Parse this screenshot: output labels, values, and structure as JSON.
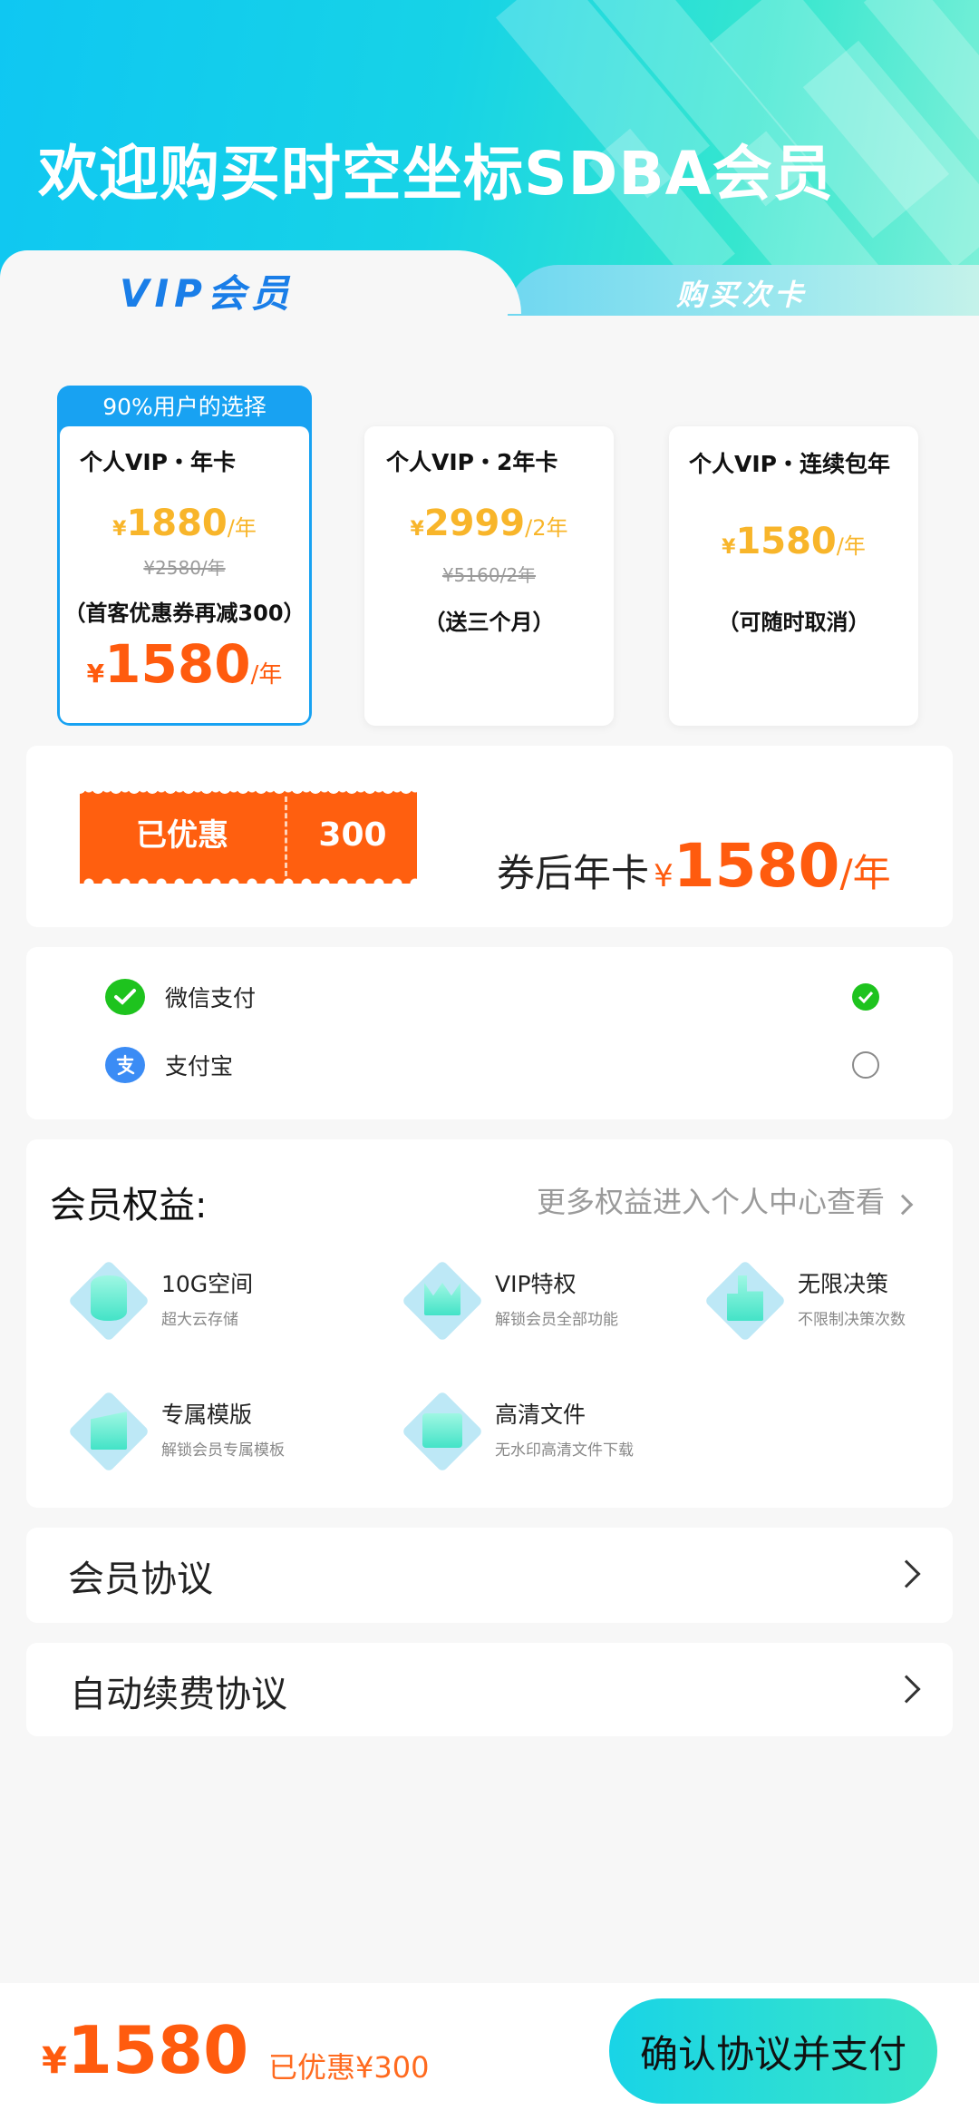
{
  "banner": {
    "title": "欢迎购买时空坐标SDBA会员",
    "tab_vip": "VIP会员",
    "tab_card": "购买次卡"
  },
  "plans": [
    {
      "badge": "90%用户的选择",
      "name": "个人VIP・年卡",
      "yen": "¥",
      "price": "1880",
      "unit": "/年",
      "old_price": "¥2580/年",
      "note": "（首客优惠券再减300）",
      "final_yen": "¥",
      "final_price": "1580",
      "final_unit": "/年",
      "selected": true
    },
    {
      "name": "个人VIP・2年卡",
      "yen": "¥",
      "price": "2999",
      "unit": "/2年",
      "old_price": "¥5160/2年",
      "note": "（送三个月）"
    },
    {
      "name": "个人VIP・连续包年",
      "yen": "¥",
      "price": "1580",
      "unit": "/年",
      "note": "（可随时取消）"
    }
  ],
  "coupon": {
    "label": "已优惠",
    "amount": "300",
    "after_label": "券后年卡",
    "after_yen": "¥",
    "after_price": "1580",
    "after_unit": "/年"
  },
  "payment": {
    "methods": [
      {
        "label": "微信支付",
        "icon": "wechat-pay-icon",
        "checked": true
      },
      {
        "label": "支付宝",
        "icon": "alipay-icon",
        "checked": false
      }
    ]
  },
  "benefits": {
    "title": "会员权益:",
    "more": "更多权益进入个人中心查看",
    "items": [
      {
        "name": "10G空间",
        "desc": "超大云存储",
        "icon": "storage-icon"
      },
      {
        "name": "VIP特权",
        "desc": "解锁会员全部功能",
        "icon": "crown-icon"
      },
      {
        "name": "无限决策",
        "desc": "不限制决策次数",
        "icon": "thumbs-up-icon"
      },
      {
        "name": "专属模版",
        "desc": "解锁会员专属模板",
        "icon": "template-icon"
      },
      {
        "name": "高清文件",
        "desc": "无水印高清文件下载",
        "icon": "hd-file-icon"
      }
    ]
  },
  "agreements": {
    "member": "会员协议",
    "auto_renew": "自动续费协议"
  },
  "footer": {
    "yen": "¥",
    "total": "1580",
    "saved": "已优惠¥300",
    "pay_button": "确认协议并支付"
  },
  "colors": {
    "accent_orange": "#ff5b0e",
    "price_gold": "#f8b52a",
    "selected_blue": "#18a2f2",
    "wechat_green": "#1ec31e",
    "alipay_blue": "#3b8cf5",
    "cta_gradient_start": "#19d4e6",
    "cta_gradient_end": "#3ae5c8"
  }
}
